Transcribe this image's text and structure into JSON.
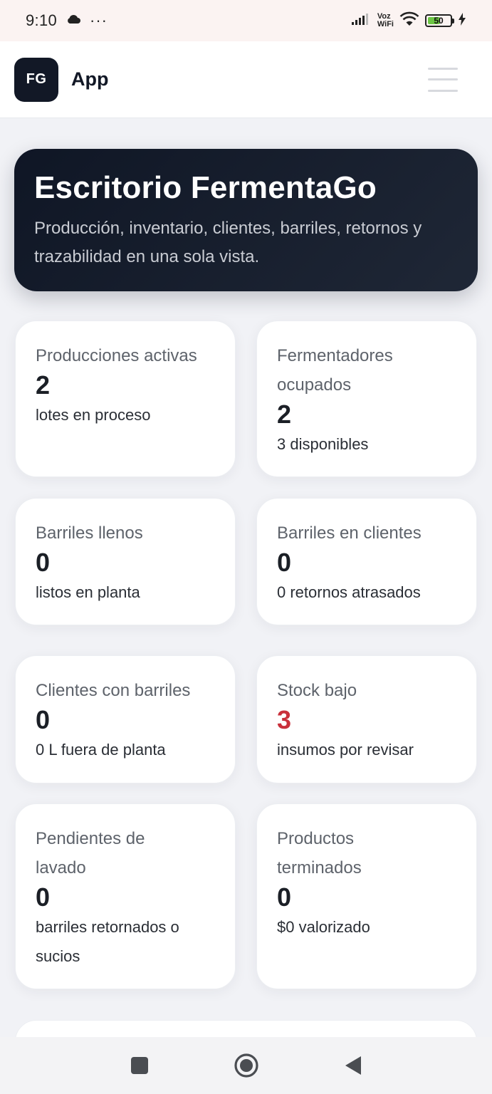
{
  "status_bar": {
    "time": "9:10",
    "dots": "···",
    "network_label_1": "Voz",
    "network_label_2": "WiFi",
    "battery": "50"
  },
  "header": {
    "logo": "FG",
    "app_name": "App",
    "menu_icon": "hamburger-menu-icon"
  },
  "hero": {
    "title": "Escritorio FermentaGo",
    "subtitle": "Producción, inventario, clientes, barriles, retornos y trazabilidad en una sola vista."
  },
  "stats": [
    {
      "label": "Producciones activas",
      "value": "2",
      "sub": "lotes en proceso"
    },
    {
      "label": "Fermentadores ocupados",
      "value": "2",
      "sub": "3 disponibles"
    },
    {
      "label": "Barriles llenos",
      "value": "0",
      "sub": "listos en planta"
    },
    {
      "label": "Barriles en clientes",
      "value": "0",
      "sub": "0 retornos atrasados"
    },
    {
      "label": "Clientes con barriles",
      "value": "0",
      "sub": "0 L fuera de planta"
    },
    {
      "label": "Stock bajo",
      "value": "3",
      "sub": "insumos por revisar"
    },
    {
      "label": "Pendientes de lavado",
      "value": "0",
      "sub": "barriles retornados o sucios"
    },
    {
      "label": "Productos terminados",
      "value": "0",
      "sub": "$0 valorizado"
    }
  ],
  "colors": {
    "hero_bg": "#121826",
    "alert_value": "#c9303b",
    "card_bg": "#ffffff",
    "page_bg": "#f1f2f6"
  },
  "nav": {
    "recents_icon": "square-recents-icon",
    "home_icon": "circle-home-icon",
    "back_icon": "triangle-back-icon"
  }
}
